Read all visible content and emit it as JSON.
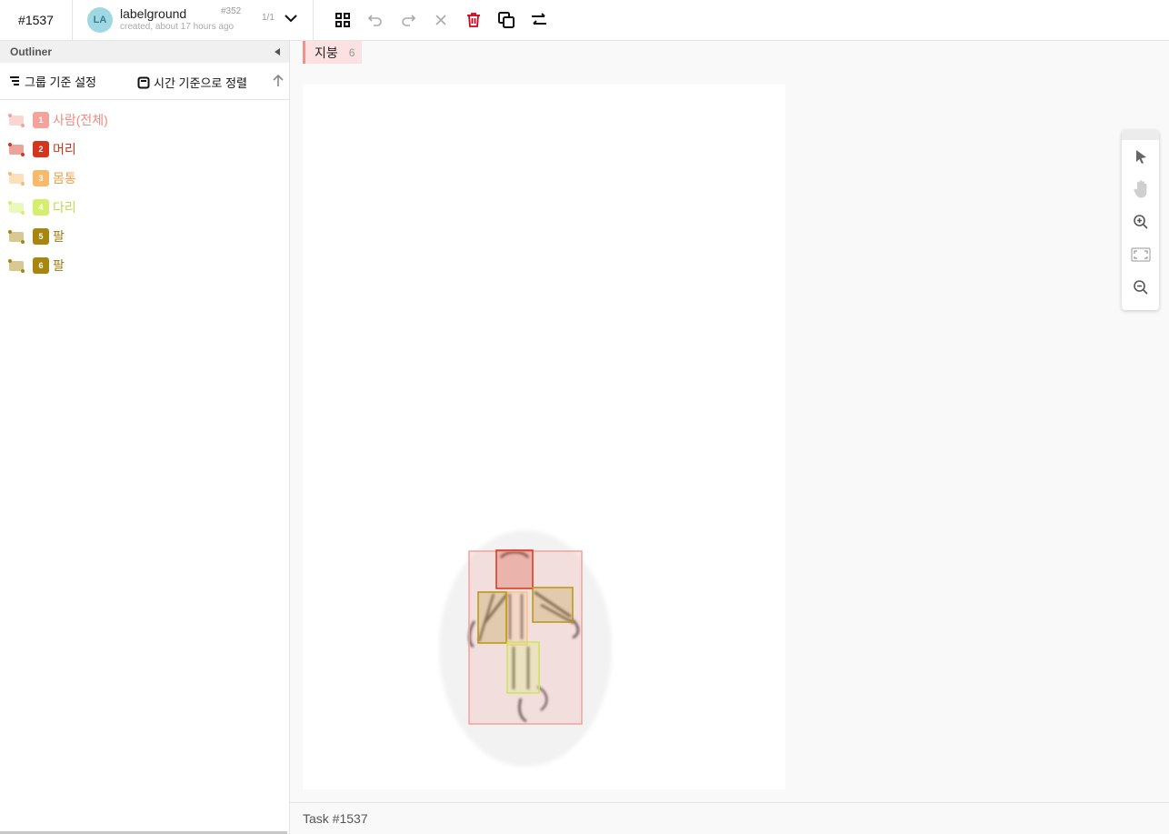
{
  "header": {
    "task_id": "#1537",
    "annotation": {
      "avatar_initials": "LA",
      "user": "labelground",
      "created": "created, about 17 hours ago",
      "number": "#352",
      "page": "1/1"
    },
    "toolbar_icons": [
      "grid-icon",
      "undo-icon",
      "redo-icon",
      "close-icon",
      "trash-icon",
      "copy-icon",
      "swap-icon"
    ]
  },
  "sidebar": {
    "title": "Outliner",
    "group_label": "그룹 기준 설정",
    "sort_label": "시간 기준으로 정렬",
    "regions": [
      {
        "index": "1",
        "label": "사람(전체)",
        "color": "#f5a29c",
        "text_color": "#f08a82"
      },
      {
        "index": "2",
        "label": "머리",
        "color": "#d4351c",
        "text_color": "#c23a20"
      },
      {
        "index": "3",
        "label": "몸통",
        "color": "#f8b96a",
        "text_color": "#f2a14a"
      },
      {
        "index": "4",
        "label": "다리",
        "color": "#d3ef6d",
        "text_color": "#bedc4e"
      },
      {
        "index": "5",
        "label": "팔",
        "color": "#a8860d",
        "text_color": "#9c7c0c"
      },
      {
        "index": "6",
        "label": "팔",
        "color": "#a8860d",
        "text_color": "#9c7c0c"
      }
    ]
  },
  "main": {
    "label_pill": {
      "text": "지붕",
      "count": "6"
    },
    "footer": "Task #1537"
  },
  "colors": {
    "accent_red": "#d0021b",
    "pill_bg": "#fbe1e1",
    "pill_border": "#f2908a"
  }
}
